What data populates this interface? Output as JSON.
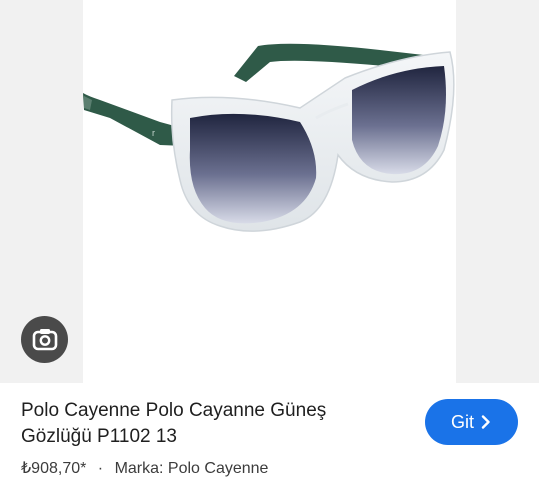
{
  "product": {
    "title": "Polo Cayenne Polo Cayanne Güneş Gözlüğü P1102 13",
    "price": "₺908,70*",
    "separator": "·",
    "brand": "Marka: Polo Cayenne"
  },
  "actions": {
    "go_label": "Git"
  },
  "icons": {
    "lens": "google-lens-camera-icon",
    "go": "chevron-right-icon"
  },
  "colors": {
    "accent": "#1a73e8",
    "temple": "#2f5a48",
    "lens_button": "#4a4a4a"
  }
}
